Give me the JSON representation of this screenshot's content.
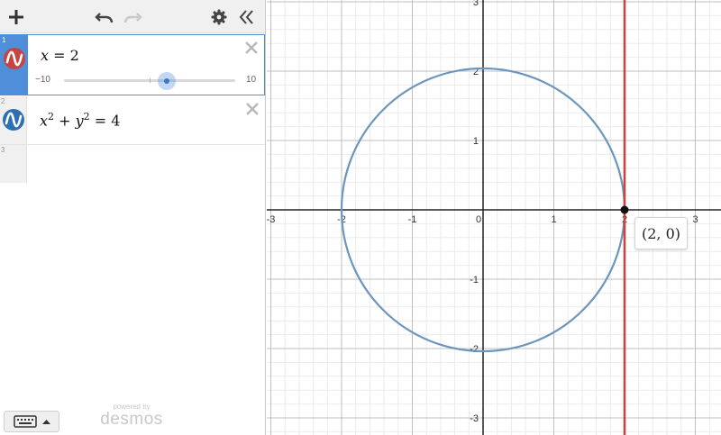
{
  "expressions": [
    {
      "index": "1",
      "lhs": "x",
      "op": "=",
      "rhs": "2",
      "color": "#c74440",
      "slider": {
        "min": "−10",
        "max": "10",
        "value": 2,
        "min_value": -10,
        "max_value": 10
      },
      "selected": true
    },
    {
      "index": "2",
      "term1_base": "x",
      "term1_exp": "2",
      "plus": "+",
      "term2_base": "y",
      "term2_exp": "2",
      "op": "=",
      "rhs": "4",
      "color": "#2d70b3",
      "selected": false
    },
    {
      "index": "3"
    }
  ],
  "toolbar": {
    "add_icon": "plus-icon",
    "undo_icon": "undo-icon",
    "redo_icon": "redo-icon",
    "settings_icon": "gear-icon",
    "collapse_icon": "double-chevron-left-icon"
  },
  "brand": {
    "small": "powered by",
    "large": "desmos"
  },
  "graph": {
    "x_ticks": [
      "-3",
      "-2",
      "-1",
      "0",
      "1",
      "2",
      "3"
    ],
    "y_ticks": [
      "3",
      "2",
      "1",
      "-1",
      "-2",
      "-3"
    ],
    "x_tick_values": [
      -3,
      -2,
      -1,
      0,
      1,
      2,
      3
    ],
    "y_tick_values": [
      3,
      2,
      1,
      -1,
      -2,
      -3
    ],
    "line_x": 2,
    "circle_radius": 2,
    "line_color": "#c74440",
    "circle_color": "#6c96bc",
    "point": {
      "x": 2,
      "y": 0,
      "label": "(2, 0)"
    }
  }
}
